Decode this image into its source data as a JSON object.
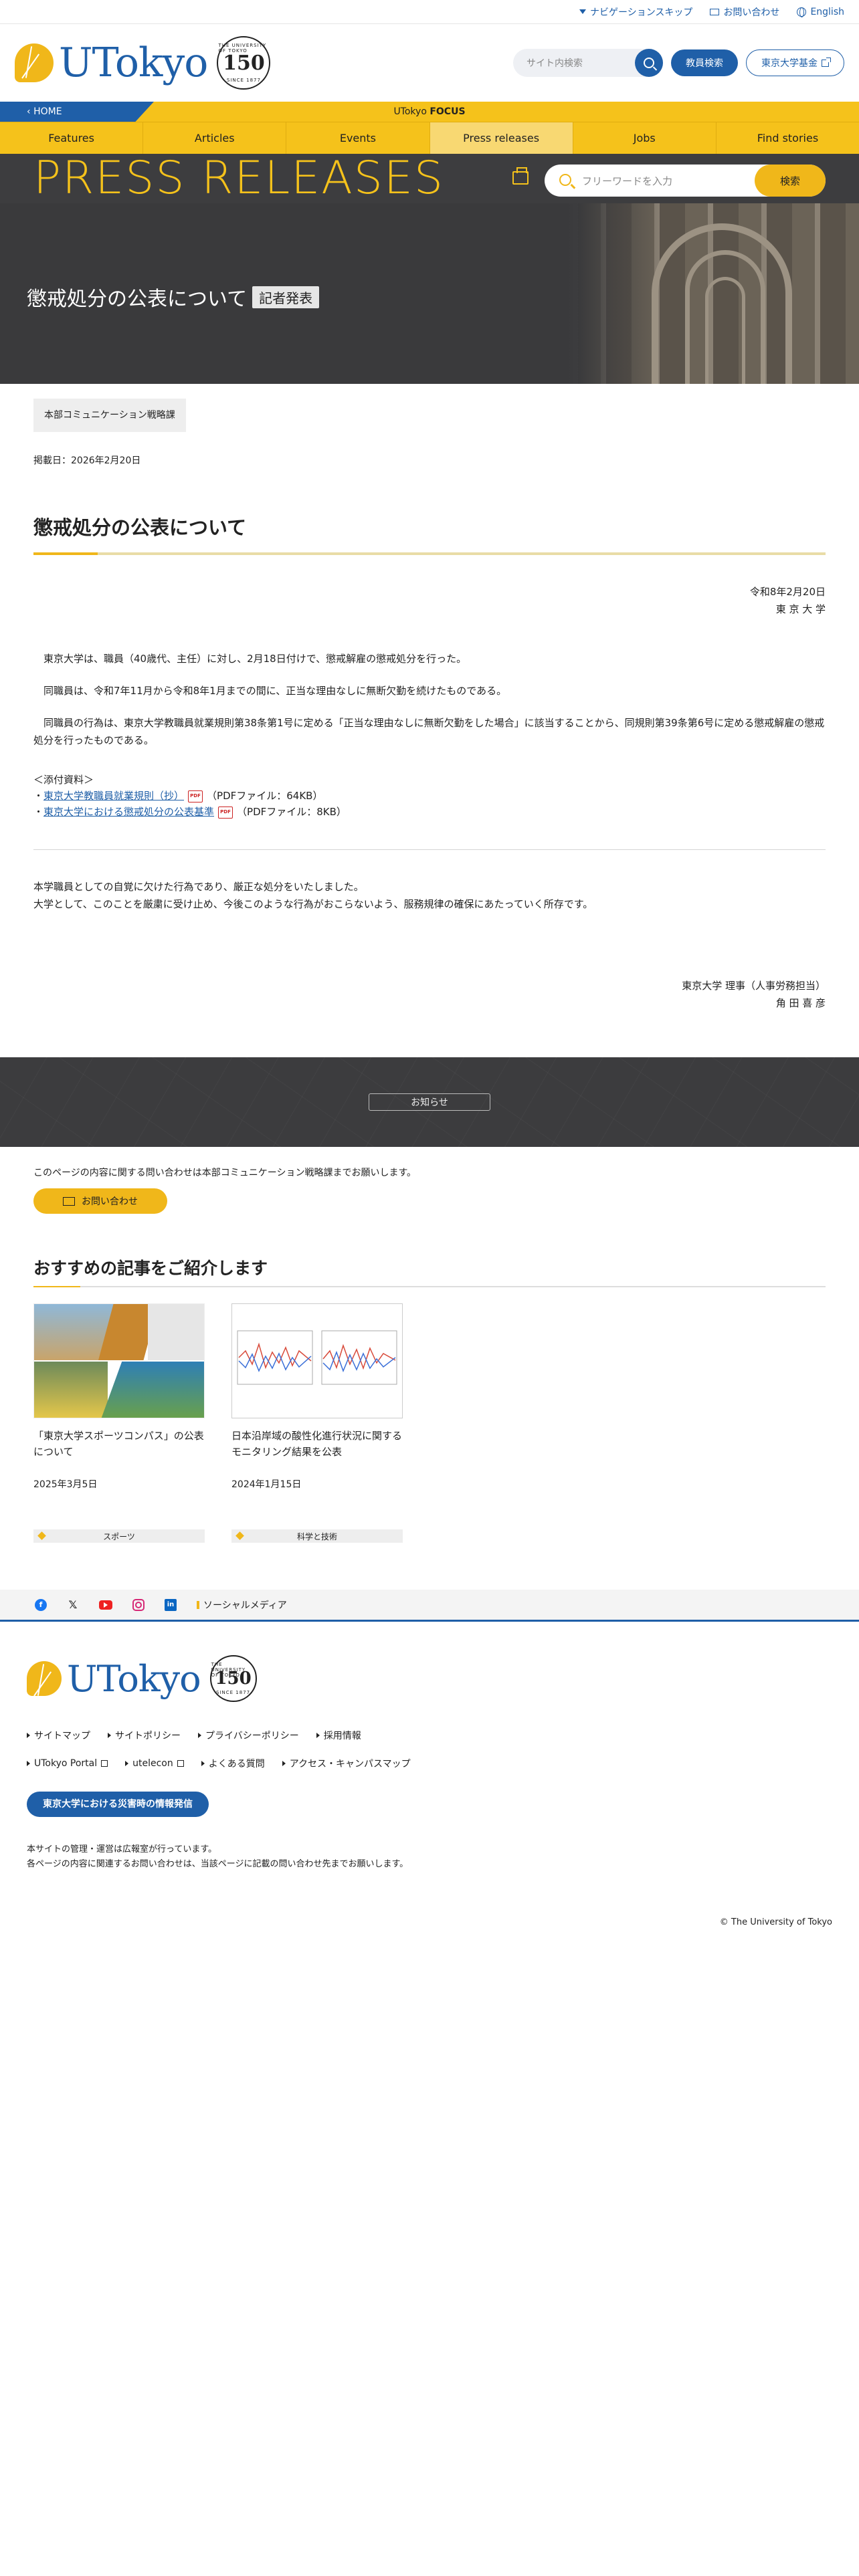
{
  "utility": {
    "skip_nav": "ナビゲーションスキップ",
    "contact": "お問い合わせ",
    "english": "English"
  },
  "header": {
    "logo": "UTokyo",
    "badge_number": "150",
    "badge_top": "THE UNIVERSITY OF TOKYO",
    "badge_bottom": "SINCE 1877",
    "site_search_placeholder": "サイト内検索",
    "faculty_search": "教員検索",
    "fund": "東京大学基金"
  },
  "home_strip": {
    "home": "HOME",
    "focus_prefix": "UTokyo ",
    "focus_bold": "FOCUS"
  },
  "nav": [
    "Features",
    "Articles",
    "Events",
    "Press releases",
    "Jobs",
    "Find stories"
  ],
  "press": {
    "title": "PRESS RELEASES",
    "search_placeholder": "フリーワードを入力",
    "search_button": "検索"
  },
  "hero": {
    "title": "懲戒処分の公表について",
    "tag": "記者発表"
  },
  "article": {
    "department": "本部コミュニケーション戦略課",
    "published": "掲載日：2026年2月20日",
    "title": "懲戒処分の公表について",
    "dateline_date": "令和8年2月20日",
    "dateline_org": "東 京 大 学",
    "para1": "　東京大学は、職員（40歳代、主任）に対し、2月18日付けで、懲戒解雇の懲戒処分を行った。",
    "para2": "　同職員は、令和7年11月から令和8年1月までの間に、正当な理由なしに無断欠勤を続けたものである。",
    "para3": "　同職員の行為は、東京大学教職員就業規則第38条第1号に定める「正当な理由なしに無断欠勤をした場合」に該当することから、同規則第39条第6号に定める懲戒解雇の懲戒処分を行ったものである。",
    "attach_head": "＜添付資料＞",
    "attach1_link": "東京大学教職員就業規則（抄）",
    "attach1_size": "（PDFファイル：64KB）",
    "attach2_link": "東京大学における懲戒処分の公表基準",
    "attach2_size": "（PDFファイル：8KB）",
    "pdf_label": "PDF",
    "closing1": "本学職員としての自覚に欠けた行為であり、厳正な処分をいたしました。",
    "closing2": "大学として、このことを厳粛に受け止め、今後このような行為がおこらないよう、服務規律の確保にあたっていく所存です。",
    "sig_title": "東京大学 理事（人事労務担当）",
    "sig_name": "角 田 喜 彦"
  },
  "notice": {
    "label": "お知らせ",
    "contact_text": "このページの内容に関する問い合わせは本部コミュニケーション戦略課までお願いします。",
    "contact_button": "お問い合わせ"
  },
  "recommended": {
    "heading": "おすすめの記事をご紹介します",
    "cards": [
      {
        "title": "「東京大学スポーツコンパス」の公表について",
        "date": "2025年3月5日",
        "category": "スポーツ"
      },
      {
        "title": "日本沿岸域の酸性化進行状況に関するモニタリング結果を公表",
        "date": "2024年1月15日",
        "category": "科学と技術"
      }
    ]
  },
  "social": {
    "label": "ソーシャルメディア",
    "x": "𝕏",
    "linkedin": "in",
    "facebook": "f"
  },
  "footer": {
    "links": [
      "サイトマップ",
      "サイトポリシー",
      "プライバシーポリシー",
      "採用情報",
      "UTokyo Portal",
      "utelecon",
      "よくある質問",
      "アクセス・キャンパスマップ"
    ],
    "disaster": "東京大学における災害時の情報発信",
    "note1": "本サイトの管理・運営は広報室が行っています。",
    "note2": "各ページの内容に関連するお問い合わせは、当該ページに記載の問い合わせ先までお願いします。",
    "copyright": "© The University of Tokyo"
  },
  "colors": {
    "brand_blue": "#1f5fa8",
    "brand_yellow": "#f5c21b",
    "dark_band": "#3d3d3f"
  }
}
